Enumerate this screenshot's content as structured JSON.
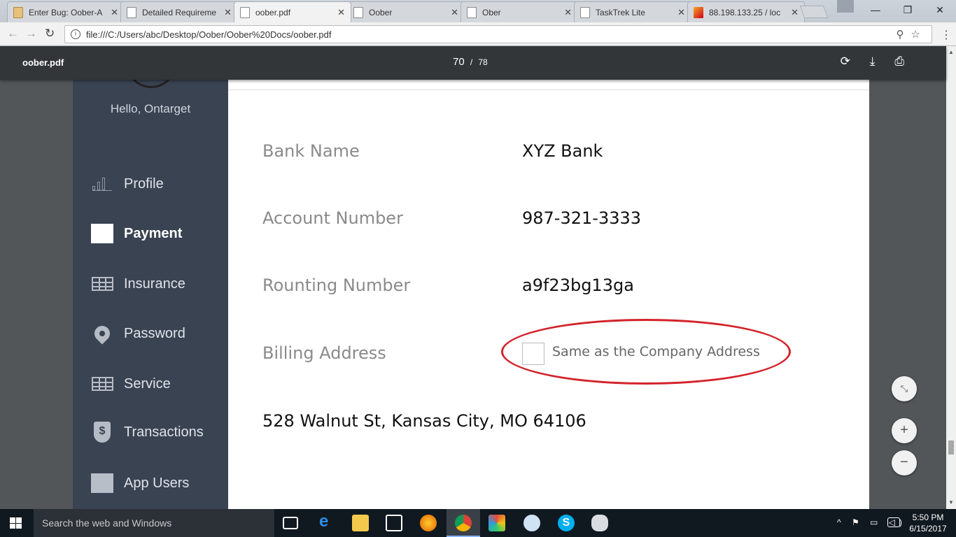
{
  "browser": {
    "tabs": [
      {
        "title": "Enter Bug: Oober-A",
        "icon": "bug-icon"
      },
      {
        "title": "Detailed Requireme",
        "icon": "page-icon"
      },
      {
        "title": "oober.pdf",
        "icon": "page-icon"
      },
      {
        "title": "Oober",
        "icon": "page-icon"
      },
      {
        "title": "Ober",
        "icon": "page-icon"
      },
      {
        "title": "TaskTrek Lite",
        "icon": "page-icon"
      },
      {
        "title": "88.198.133.25 / loc",
        "icon": "pma-icon"
      }
    ],
    "url": "file:///C:/Users/abc/Desktop/Oober/Oober%20Docs/oober.pdf"
  },
  "pdf": {
    "filename": "oober.pdf",
    "current_page": "70",
    "page_separator": "/",
    "total_pages": "78"
  },
  "sidebar": {
    "greeting": "Hello, Ontarget",
    "items": [
      {
        "label": "Profile",
        "icon": "bar-chart-icon"
      },
      {
        "label": "Payment",
        "icon": "square-icon"
      },
      {
        "label": "Insurance",
        "icon": "grid-icon"
      },
      {
        "label": "Password",
        "icon": "location-pin-icon"
      },
      {
        "label": "Service",
        "icon": "grid-icon"
      },
      {
        "label": "Transactions",
        "icon": "dollar-shield-icon"
      },
      {
        "label": "App Users",
        "icon": "square-icon"
      }
    ]
  },
  "payment": {
    "bank_name_label": "Bank Name",
    "bank_name_value": "XYZ Bank",
    "account_number_label": "Account Number",
    "account_number_value": "987-321-3333",
    "routing_number_label": "Rounting Number",
    "routing_number_value": "a9f23bg13ga",
    "billing_address_label": "Billing Address",
    "same_as_company_label": "Same as the Company Address",
    "address": "528 Walnut St, Kansas City, MO 64106"
  },
  "taskbar": {
    "search_placeholder": "Search the web and Windows",
    "time": "5:50 PM",
    "date": "6/15/2017"
  },
  "colors": {
    "sidebar_bg": "#3a4352",
    "annotation_red": "#d3232b",
    "pdf_toolbar": "#323639"
  }
}
